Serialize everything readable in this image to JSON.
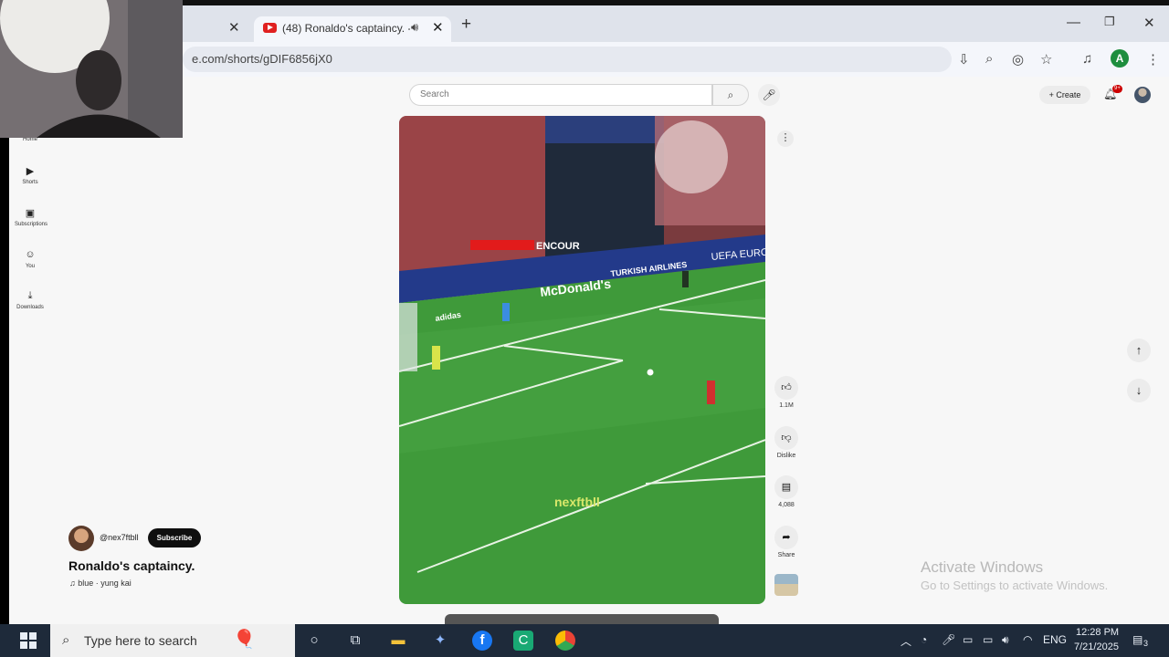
{
  "browser": {
    "tab_title": "(48) Ronaldo's captaincy. -",
    "url": "e.com/shorts/gDIF6856jX0",
    "profile_letter": "A",
    "new_tab_symbol": "+",
    "close_symbol": "✕"
  },
  "youtube": {
    "search_placeholder": "Search",
    "create_label": "+ Create",
    "notification_count": "9+",
    "sidebar": [
      {
        "label": "Home",
        "icon": "home-icon"
      },
      {
        "label": "Shorts",
        "icon": "shorts-icon"
      },
      {
        "label": "Subscriptions",
        "icon": "subscriptions-icon"
      },
      {
        "label": "You",
        "icon": "you-icon"
      },
      {
        "label": "Downloads",
        "icon": "downloads-icon"
      }
    ],
    "video_overlay": {
      "caption": "ENCOUR",
      "watermark": "nexftbll",
      "ad_mcdonalds": "McDonald's",
      "ad_turkish": "TURKISH AIRLINES",
      "ad_uefa": "UEFA EURO",
      "ad_adidas": "adidas"
    },
    "actions": {
      "like_count": "1.1M",
      "dislike_label": "Dislike",
      "comments_count": "4,088",
      "share_label": "Share"
    },
    "channel_name": "@nex7ftbll",
    "subscribe_label": "Subscribe",
    "video_title": "Ronaldo's captaincy.",
    "music": "blue · yung kai"
  },
  "watermark": {
    "line1": "Activate Windows",
    "line2": "Go to Settings to activate Windows."
  },
  "taskbar": {
    "search_placeholder": "Type here to search",
    "language": "ENG",
    "time": "12:28 PM",
    "date": "7/21/2025",
    "notification_count": "3"
  }
}
